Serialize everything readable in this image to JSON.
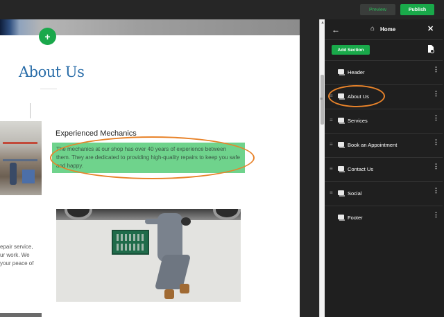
{
  "topbar": {
    "preview_label": "Preview",
    "publish_label": "Publish"
  },
  "canvas": {
    "add_icon": "+",
    "about_title": "About Us",
    "experience_heading": "Experienced Mechanics",
    "experience_text": "The mechanics at our shop has over 40 years of experience between them. They are dedicated to providing high-quality repairs to keep you safe and happy.",
    "side_text_lines": [
      "epair service,",
      "ur work. We",
      " your peace of"
    ]
  },
  "panel": {
    "back_icon": "←",
    "home_icon": "⌂",
    "title": "Home",
    "close_icon": "✕",
    "add_section_label": "Add Section",
    "page_settings_icon": "page-gear-icon",
    "sections": [
      {
        "label": "Header",
        "draggable": false
      },
      {
        "label": "About Us",
        "draggable": true
      },
      {
        "label": "Services",
        "draggable": true
      },
      {
        "label": "Book an Appointment",
        "draggable": true
      },
      {
        "label": "Contact Us",
        "draggable": true
      },
      {
        "label": "Social",
        "draggable": true
      },
      {
        "label": "Footer",
        "draggable": false
      }
    ]
  },
  "colors": {
    "accent_green": "#19a94a",
    "highlight_green": "#6fd38c",
    "annotation_orange": "#e8832a",
    "title_blue": "#2b6ea9",
    "panel_bg": "#1f1f1f"
  }
}
